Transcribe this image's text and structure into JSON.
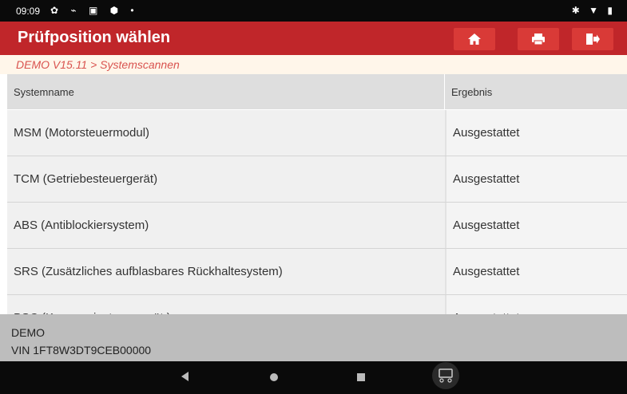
{
  "status": {
    "time": "09:09",
    "left_icons": "✿ ⌁ ▣ ⬢ •",
    "right_icons": "✱ ▼ ▮"
  },
  "header": {
    "title": "Prüfposition wählen",
    "buttons": [
      "home-icon",
      "print-icon",
      "exit-icon"
    ],
    "accent": "#c0262a"
  },
  "breadcrumb": "DEMO V15.11 > Systemscannen",
  "table": {
    "headers": [
      "Systemname",
      "Ergebnis"
    ],
    "rows": [
      {
        "name": "MSM (Motorsteuermodul)",
        "result": "Ausgestattet"
      },
      {
        "name": "TCM (Getriebesteuergerät)",
        "result": "Ausgestattet"
      },
      {
        "name": "ABS (Antiblockiersystem)",
        "result": "Ausgestattet"
      },
      {
        "name": "SRS (Zusätzliches aufblasbares Rückhaltesystem)",
        "result": "Ausgestattet"
      },
      {
        "name": "BSC (Karosseriesteuergerät )",
        "result": "Ausgestattet"
      }
    ]
  },
  "footer": {
    "line1": "DEMO",
    "line2": "VIN 1FT8W3DT9CEB00000"
  }
}
